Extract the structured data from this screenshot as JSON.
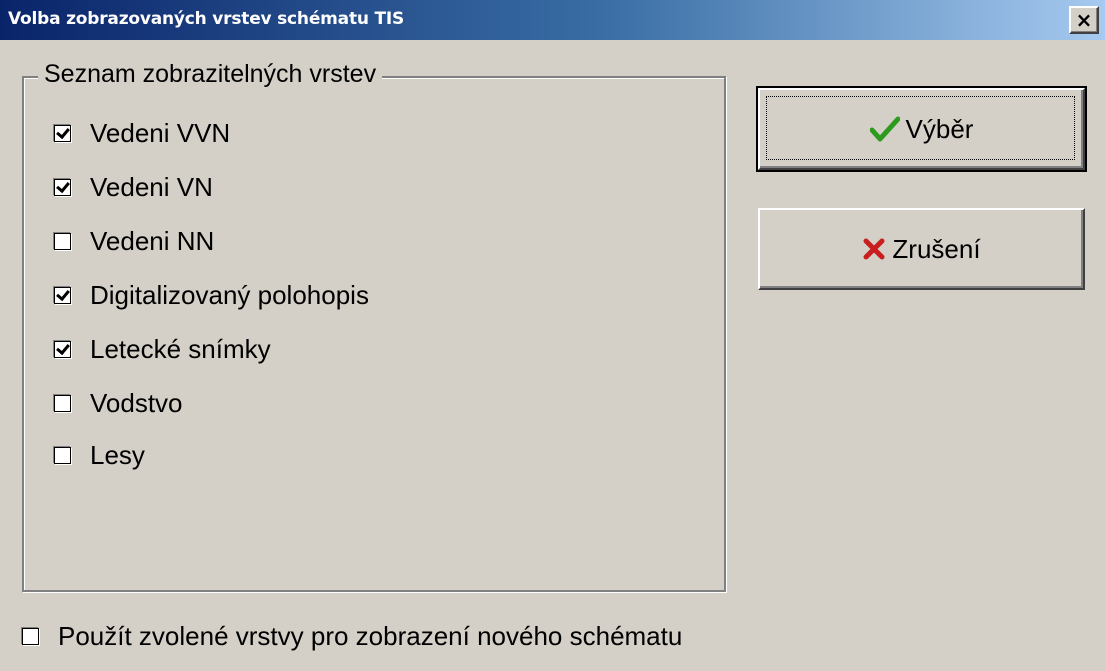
{
  "window": {
    "title": "Volba zobrazovaných vrstev schématu TIS",
    "close_label": "×"
  },
  "group": {
    "legend": "Seznam zobrazitelných vrstev",
    "items": [
      {
        "label": "Vedeni VVN",
        "checked": true
      },
      {
        "label": "Vedeni VN",
        "checked": true
      },
      {
        "label": "Vedeni NN",
        "checked": false
      },
      {
        "label": "Digitalizovaný polohopis",
        "checked": true
      },
      {
        "label": "Letecké snímky",
        "checked": true
      },
      {
        "label": "Vodstvo",
        "checked": false
      },
      {
        "label": "Lesy",
        "checked": false
      }
    ]
  },
  "buttons": {
    "ok_label": "Výběr",
    "ok_icon": "check-icon",
    "cancel_label": "Zrušení",
    "cancel_icon": "cross-icon"
  },
  "bottom_option": {
    "label": "Použít zvolené vrstvy pro zobrazení nového schématu",
    "checked": false
  },
  "colors": {
    "titlebar_start": "#0a246a",
    "titlebar_end": "#a6caf0",
    "face": "#d4d0c8",
    "check_green": "#2e9a1e",
    "cross_red": "#c81e1e"
  }
}
